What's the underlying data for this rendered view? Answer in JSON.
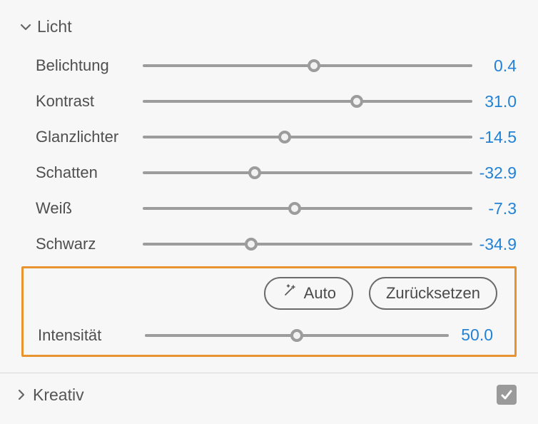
{
  "sections": {
    "licht": {
      "title": "Licht",
      "expanded": true,
      "sliders": [
        {
          "label": "Belichtung",
          "value": "0.4",
          "pos": 52
        },
        {
          "label": "Kontrast",
          "value": "31.0",
          "pos": 65
        },
        {
          "label": "Glanzlichter",
          "value": "-14.5",
          "pos": 43
        },
        {
          "label": "Schatten",
          "value": "-32.9",
          "pos": 34
        },
        {
          "label": "Weiß",
          "value": "-7.3",
          "pos": 46
        },
        {
          "label": "Schwarz",
          "value": "-34.9",
          "pos": 33
        }
      ],
      "auto_label": "Auto",
      "reset_label": "Zurücksetzen",
      "intensity": {
        "label": "Intensität",
        "value": "50.0",
        "pos": 50
      }
    },
    "kreativ": {
      "title": "Kreativ",
      "expanded": false,
      "checked": true
    }
  }
}
